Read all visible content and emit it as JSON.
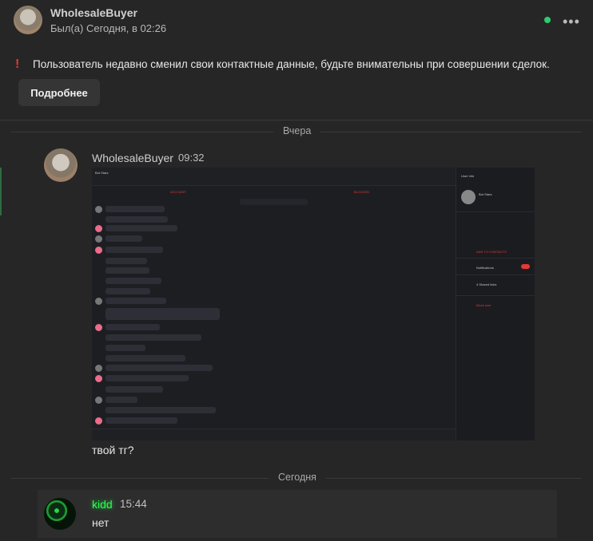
{
  "header": {
    "username": "WholesaleBuyer",
    "status": "Был(а) Сегодня, в 02:26",
    "more_icon": "•••",
    "online_color": "#2ecc71"
  },
  "notice": {
    "icon": "!",
    "text": "Пользователь недавно сменил свои контактные данные, будьте внимательны при совершении сделок.",
    "details_label": "Подробнее"
  },
  "days": {
    "yesterday": "Вчера",
    "today": "Сегодня"
  },
  "messages": [
    {
      "author": "WholesaleBuyer",
      "time": "09:32",
      "attachment": "screenshot-image",
      "text": "твой тг?"
    },
    {
      "author": "kidd",
      "time": "15:44",
      "text": "нет",
      "name_color": "#2bff4f"
    }
  ],
  "screenshot": {
    "chat_title": "Bot Stars",
    "side_title": "User Info",
    "side_user": "Bot Stars",
    "red_left": "ACCOUNT",
    "red_right": "BLOCKED",
    "add_contacts": "ADD TO CONTACTS",
    "notifications": "Notifications",
    "shared_links": "4 Shared links",
    "block": "Block user"
  }
}
